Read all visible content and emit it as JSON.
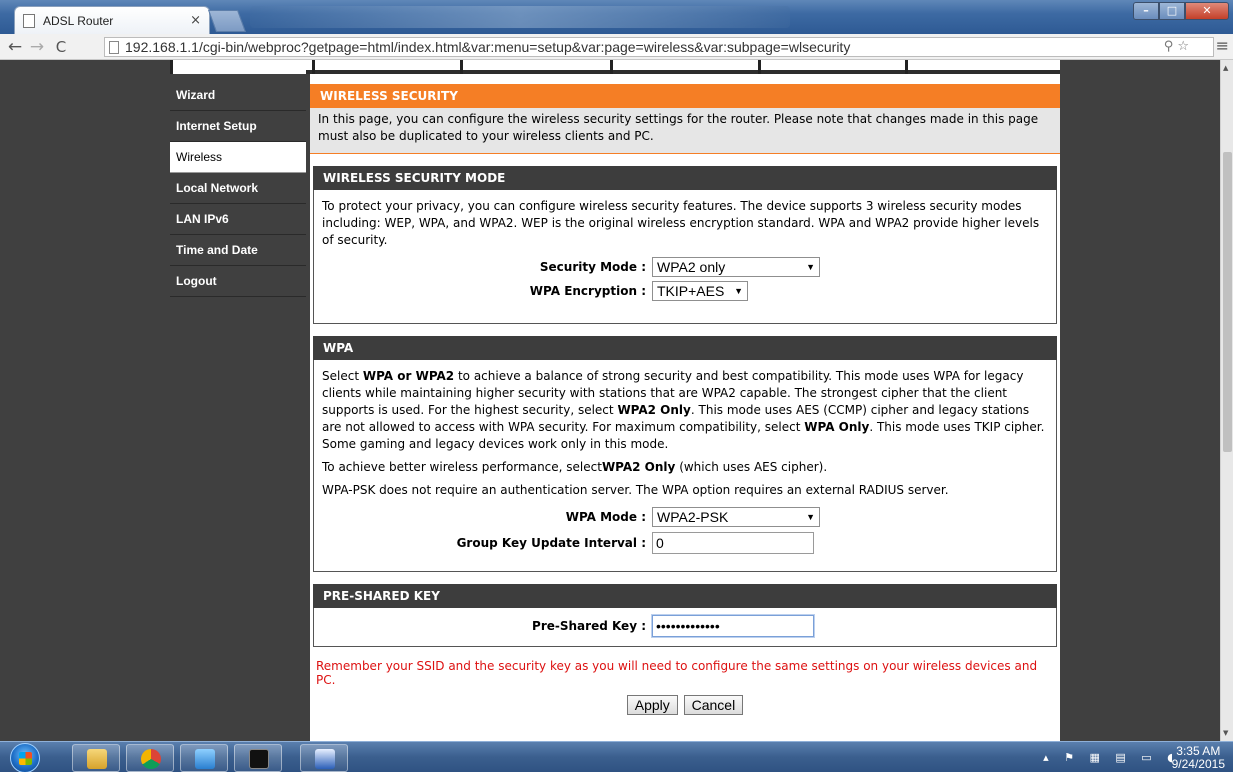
{
  "browser": {
    "tab_title": "ADSL Router",
    "tab_close": "×",
    "url": "192.168.1.1/cgi-bin/webproc?getpage=html/index.html&var:menu=setup&var:page=wireless&var:subpage=wlsecurity"
  },
  "sidebar": {
    "items": [
      {
        "label": "Wizard"
      },
      {
        "label": "Internet Setup"
      },
      {
        "label": "Wireless"
      },
      {
        "label": "Local Network"
      },
      {
        "label": "LAN IPv6"
      },
      {
        "label": "Time and Date"
      },
      {
        "label": "Logout"
      }
    ],
    "active_index": 2
  },
  "wireless_security": {
    "title": "WIRELESS SECURITY",
    "intro": "In this page, you can configure the wireless security settings for the router. Please note that changes made in this page must also be duplicated to your wireless clients and PC."
  },
  "security_mode": {
    "title": "WIRELESS SECURITY MODE",
    "description": "To protect your privacy, you can configure wireless security features. The device supports 3 wireless security modes including: WEP, WPA, and WPA2. WEP is the original wireless encryption standard. WPA and WPA2 provide higher levels of security.",
    "mode_label": "Security Mode :",
    "mode_value": "WPA2 only",
    "encryption_label": "WPA Encryption :",
    "encryption_value": "TKIP+AES"
  },
  "wpa": {
    "title": "WPA",
    "p1_a": "Select ",
    "p1_b": "WPA or WPA2",
    "p1_c": " to achieve a balance of strong security and best compatibility. This mode uses WPA for legacy clients while maintaining higher security with stations that are WPA2 capable. The strongest cipher that the client supports is used. For the highest security, select ",
    "p1_d": "WPA2 Only",
    "p1_e": ". This mode uses AES (CCMP) cipher and legacy stations are not allowed to access with WPA security. For maximum compatibility, select ",
    "p1_f": "WPA Only",
    "p1_g": ". This mode uses TKIP cipher. Some gaming and legacy devices work only in this mode.",
    "p2_a": "To achieve better wireless performance, select",
    "p2_b": "WPA2 Only",
    "p2_c": " (which uses AES cipher).",
    "p3": "WPA-PSK does not require an authentication server. The WPA option requires an external RADIUS server.",
    "mode_label": "WPA Mode :",
    "mode_value": "WPA2-PSK",
    "interval_label": "Group Key Update Interval :",
    "interval_value": "0"
  },
  "psk": {
    "title": "PRE-SHARED KEY",
    "label": "Pre-Shared Key :",
    "value": "•••••••••••••"
  },
  "note": "Remember your SSID and the security key as you will need to configure the same settings on your wireless devices and PC.",
  "buttons": {
    "apply": "Apply",
    "cancel": "Cancel"
  },
  "taskbar": {
    "time": "3:35 AM",
    "date": "9/24/2015"
  },
  "colors": {
    "accent": "#f57e25",
    "section": "#3d3d3d",
    "note": "#dd1111"
  }
}
